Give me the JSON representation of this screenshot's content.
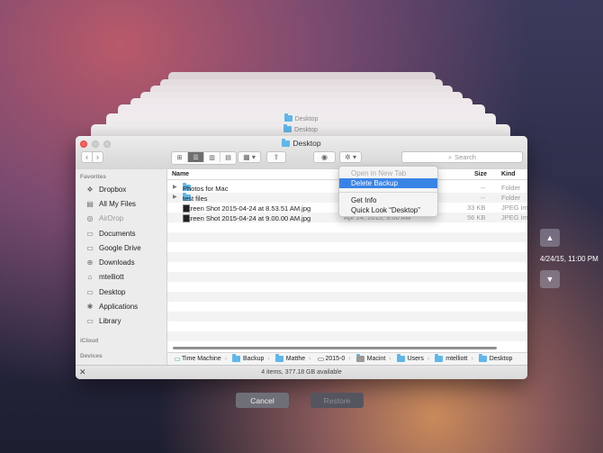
{
  "window": {
    "title": "Desktop",
    "ghost_titles": [
      "Desktop",
      "Desktop"
    ]
  },
  "toolbar": {
    "search_placeholder": "Search"
  },
  "sidebar": {
    "favorites_header": "Favorites",
    "favorites": [
      {
        "label": "Dropbox",
        "icon": "dropbox-icon"
      },
      {
        "label": "All My Files",
        "icon": "all-files-icon"
      },
      {
        "label": "AirDrop",
        "icon": "airdrop-icon"
      },
      {
        "label": "Documents",
        "icon": "documents-icon"
      },
      {
        "label": "Google Drive",
        "icon": "google-drive-icon"
      },
      {
        "label": "Downloads",
        "icon": "downloads-icon"
      },
      {
        "label": "mtelliott",
        "icon": "home-icon"
      },
      {
        "label": "Desktop",
        "icon": "desktop-icon"
      },
      {
        "label": "Applications",
        "icon": "applications-icon"
      },
      {
        "label": "Library",
        "icon": "folder-icon"
      }
    ],
    "icloud_header": "iCloud",
    "devices_header": "Devices"
  },
  "columns": {
    "name": "Name",
    "size": "Size",
    "kind": "Kind"
  },
  "files": [
    {
      "name": "Photos for Mac",
      "date": "",
      "size": "--",
      "kind": "Folder"
    },
    {
      "name": "test files",
      "date": "",
      "size": "--",
      "kind": "Folder"
    },
    {
      "name": "Screen Shot 2015-04-24 at 8.53.51 AM.jpg",
      "date": "",
      "size": "33 KB",
      "kind": "JPEG im"
    },
    {
      "name": "Screen Shot 2015-04-24 at 9.00.00 AM.jpg",
      "date": "Apr 24, 2015, 9:00 AM",
      "size": "56 KB",
      "kind": "JPEG im"
    }
  ],
  "context_menu": {
    "items": [
      {
        "label": "Open in New Tab",
        "state": "disabled"
      },
      {
        "label": "Delete Backup",
        "state": "highlighted"
      },
      {
        "label": "Get Info",
        "state": "normal"
      },
      {
        "label": "Quick Look “Desktop”",
        "state": "normal"
      }
    ]
  },
  "path_bar": [
    "Time Machine",
    "Backup",
    "Matthe",
    "2015-0",
    "Macint",
    "Users",
    "mtelliott",
    "Desktop"
  ],
  "status": {
    "text": "4 items, 377.18 GB available"
  },
  "time_machine": {
    "date": "4/24/15, 11:00 PM",
    "up_icon": "chevron-up-icon",
    "down_icon": "chevron-down-icon"
  },
  "buttons": {
    "cancel": "Cancel",
    "restore": "Restore"
  },
  "colors": {
    "selection": "#3a83e6",
    "folder": "#5fb7ea",
    "close": "#fc605c"
  }
}
